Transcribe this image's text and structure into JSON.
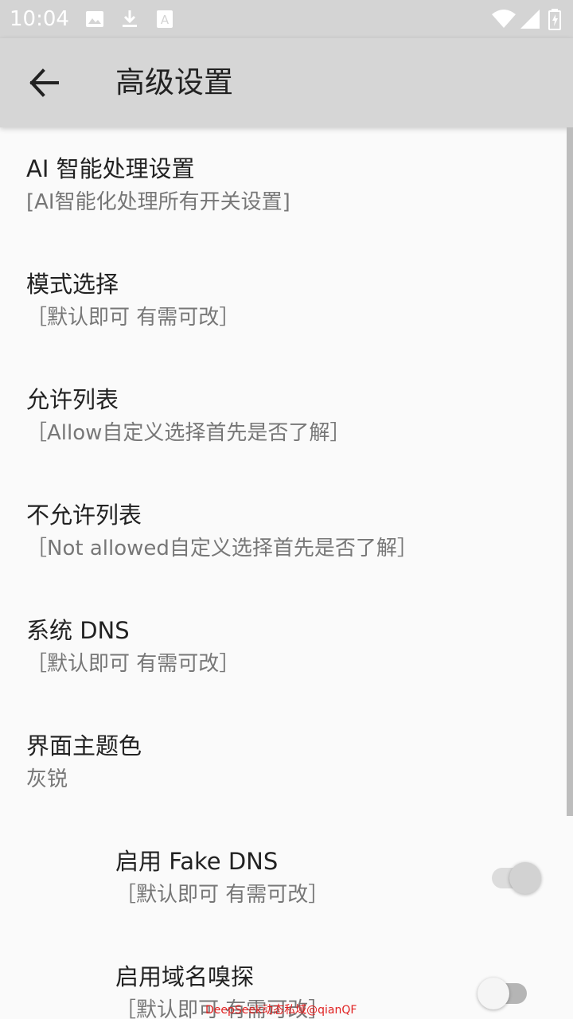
{
  "status_bar": {
    "time": "10:04",
    "icons_left": [
      "image-icon",
      "download-icon",
      "font-icon"
    ],
    "icons_right": [
      "wifi-icon",
      "signal-icon",
      "battery-charging-icon"
    ]
  },
  "app_bar": {
    "back_icon": "arrow-left-icon",
    "title": "高级设置"
  },
  "preferences": [
    {
      "title": "AI 智能处理设置",
      "summary": "[AI智能化处理所有开关设置]"
    },
    {
      "title": "模式选择",
      "summary": "［默认即可 有需可改］"
    },
    {
      "title": "允许列表",
      "summary": "［Allow自定义选择首先是否了解］"
    },
    {
      "title": "不允许列表",
      "summary": "［Not allowed自定义选择首先是否了解］"
    },
    {
      "title": "系统 DNS",
      "summary": "［默认即可 有需可改］"
    },
    {
      "title": "界面主题色",
      "summary": "灰锐"
    }
  ],
  "switch_preferences": [
    {
      "title": "启用 Fake DNS",
      "summary": "［默认即可 有需可改］",
      "checked": true
    },
    {
      "title": "启用域名嗅探",
      "summary": "［默认即可 有需可改］",
      "checked": false
    }
  ],
  "colors": {
    "status_bar": "#d4d4d4",
    "app_bar": "#d6d6d6",
    "background": "#fafafa",
    "switch_on_track": "#dcdcdc",
    "switch_on_thumb": "#d2d2d2",
    "switch_off_track": "#b5b5b5",
    "switch_off_thumb": "#f5f5f5",
    "watermark": "#e02020"
  },
  "watermark": "DeepSeek动态私域@qianQF"
}
